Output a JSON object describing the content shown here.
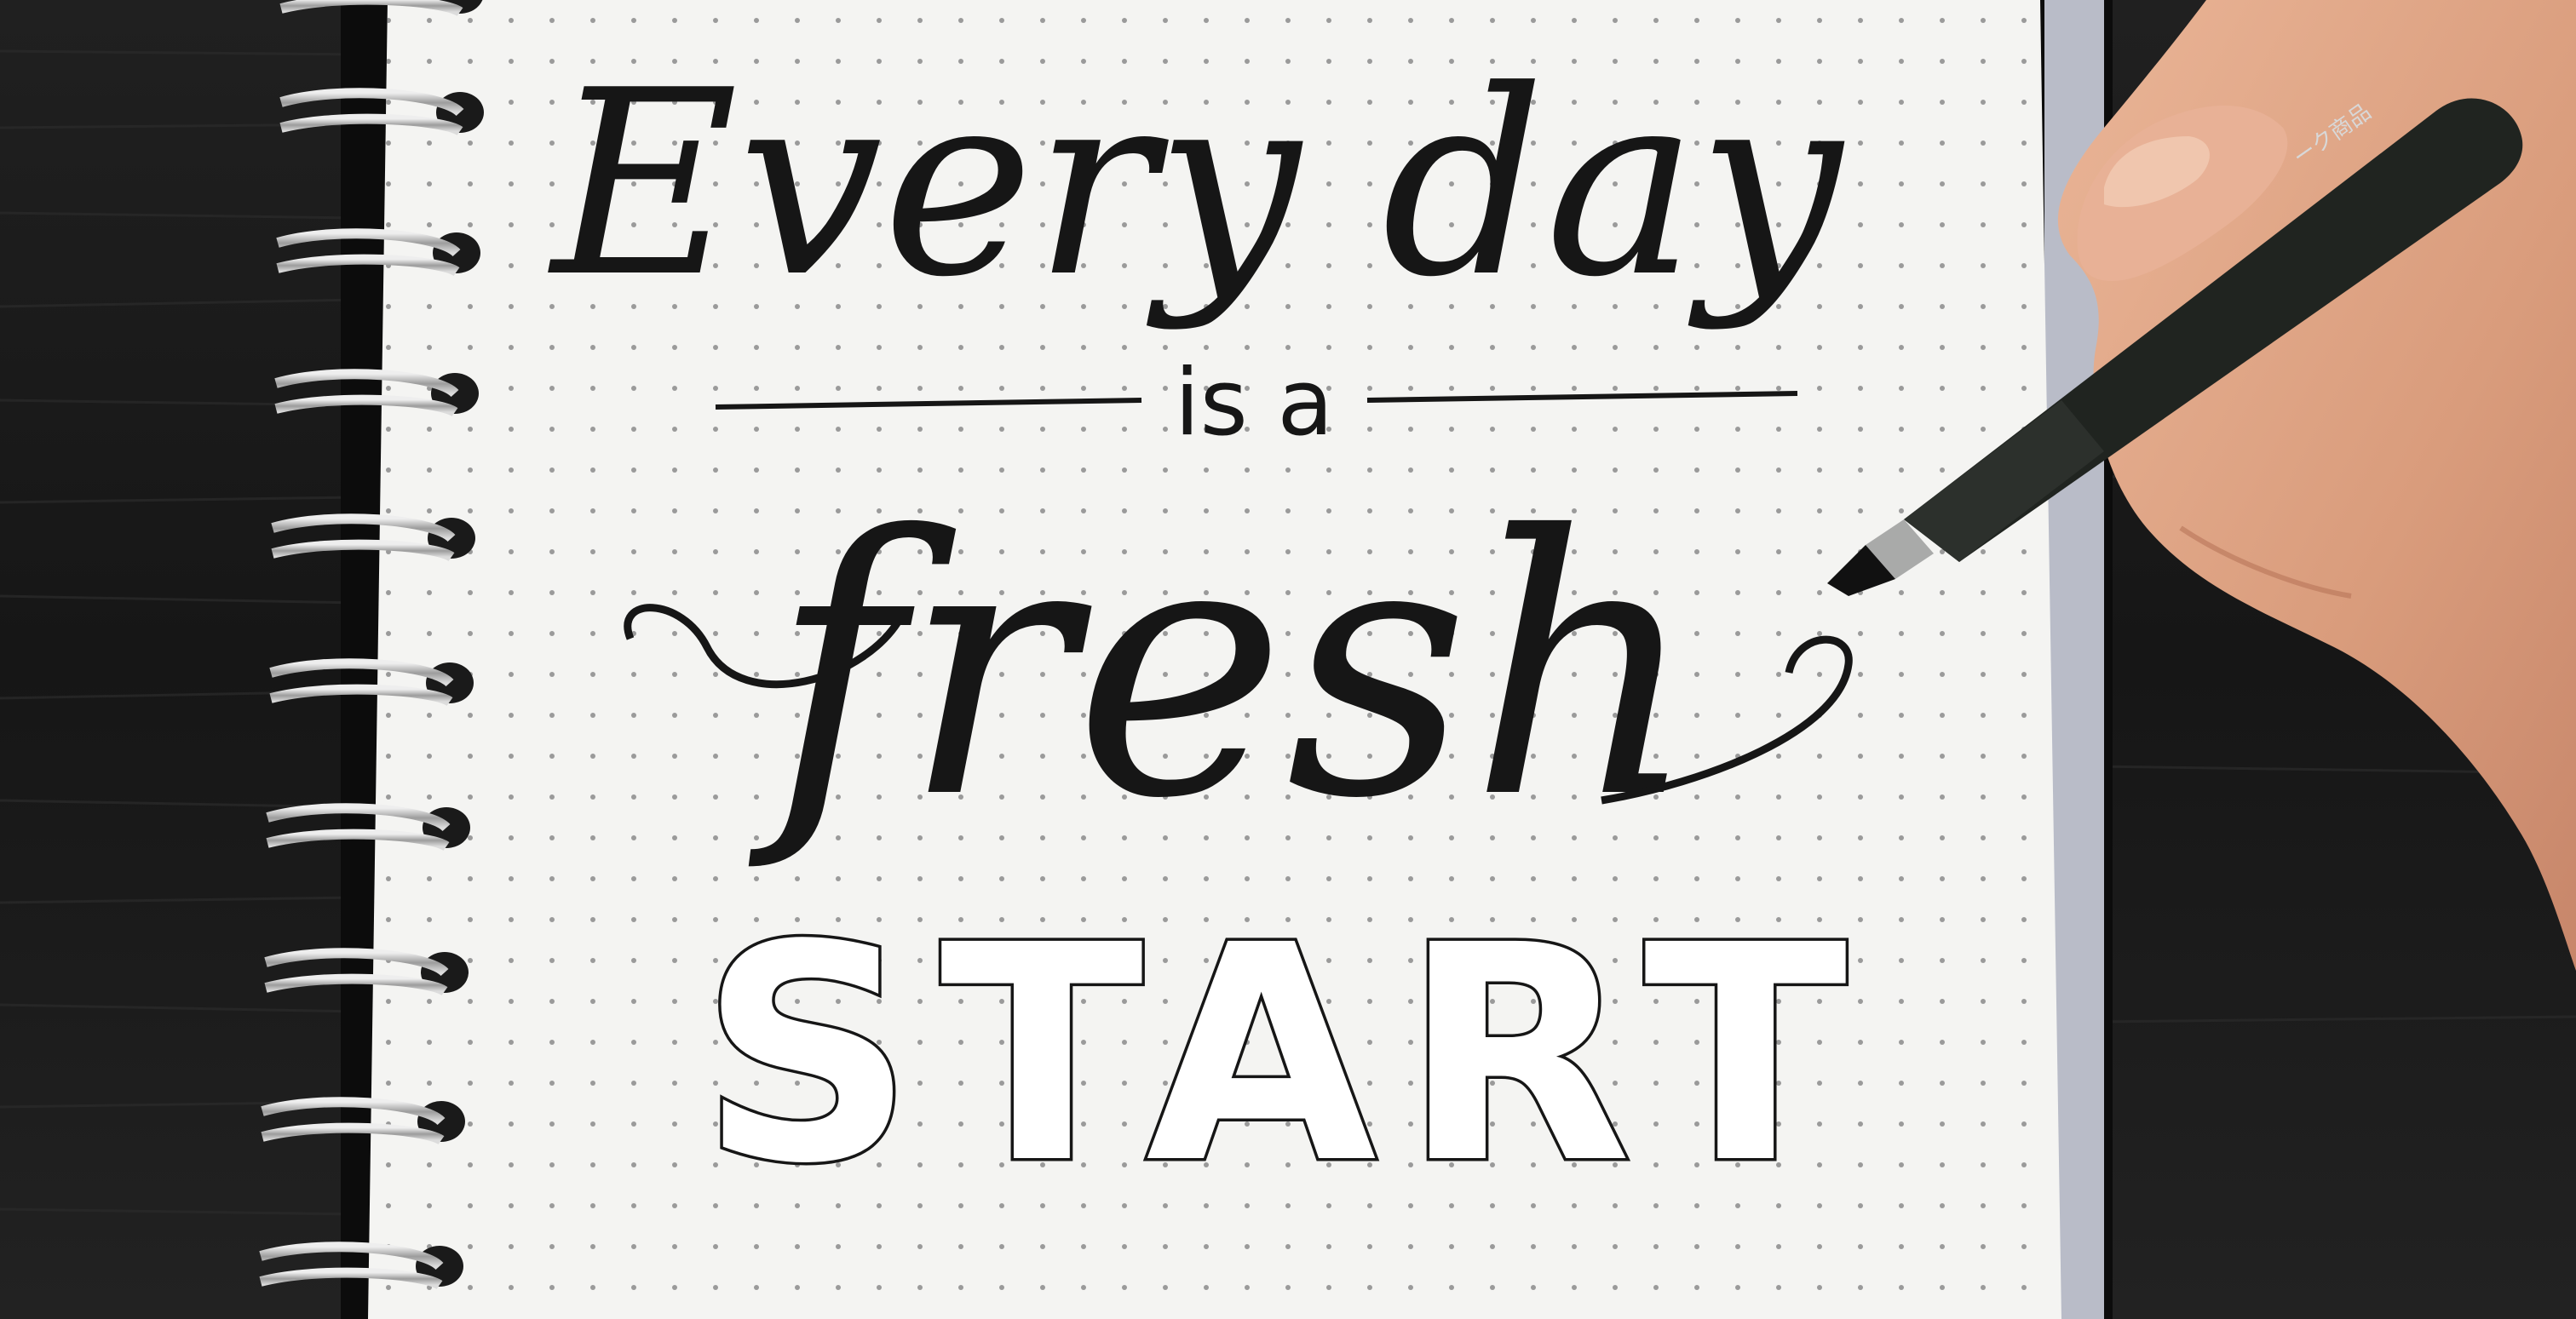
{
  "photo": {
    "lettering": {
      "line1": "Every day",
      "line2": "is a",
      "line3": "fresh",
      "line4": "START"
    },
    "pen_label": "ーク商品",
    "colors": {
      "desk": "#1c1c1c",
      "paper": "#f4f4f2",
      "ink": "#161616",
      "dots": "#9a9a9a",
      "ring_metal": "#c9c9c9",
      "skin": "#e0a98a",
      "pen_body": "#202420"
    },
    "icons": [
      "spiral-binding-icon",
      "brush-pen-icon",
      "hand-icon"
    ]
  }
}
